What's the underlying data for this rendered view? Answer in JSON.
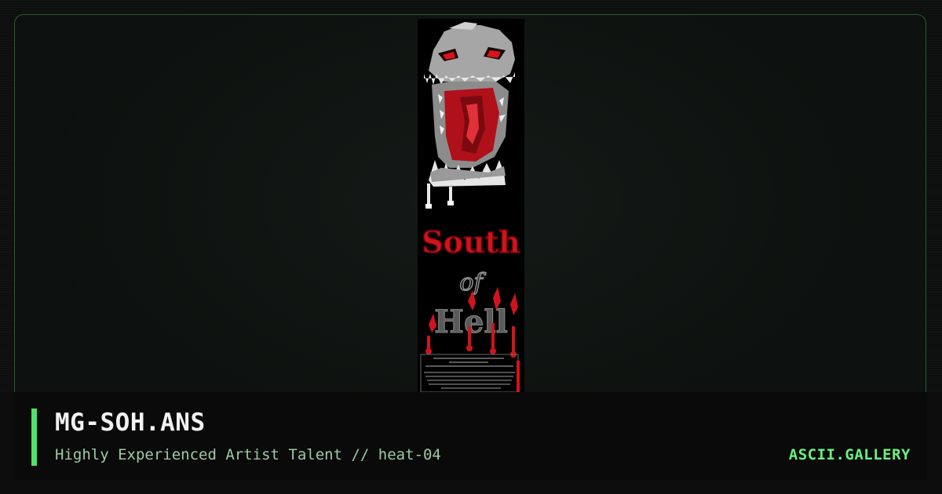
{
  "artwork": {
    "name": "MG-SOH.ANS",
    "subtitle": "Highly Experienced Artist Talent // heat-04",
    "logo_text_line1": "South",
    "logo_text_line2": "of",
    "logo_text_line3": "Hell"
  },
  "site": {
    "brand": "ASCII.GALLERY"
  },
  "colors": {
    "accent": "#4ee36b",
    "brand": "#6cf07f",
    "frame_border": "#2b5a33",
    "background": "#0c0f0e",
    "art_red": "#c8141c",
    "art_gray": "#9a9a9a"
  }
}
